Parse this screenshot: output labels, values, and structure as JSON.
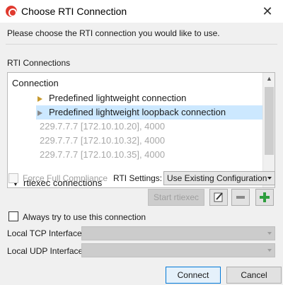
{
  "window": {
    "title": "Choose RTI Connection"
  },
  "prompt": "Please choose the RTI connection you would like to use.",
  "group_label": "RTI Connections",
  "tree": {
    "header": "Connection",
    "items": [
      {
        "label": "Predefined lightweight connection",
        "state": "normal"
      },
      {
        "label": "Predefined lightweight loopback connection",
        "state": "selected"
      },
      {
        "label": "229.7.7.7 [172.10.10.20], 4000",
        "state": "disabled"
      },
      {
        "label": "229.7.7.7 [172.10.10.32], 4000",
        "state": "disabled"
      },
      {
        "label": "229.7.7.7 [172.10.10.35], 4000",
        "state": "disabled"
      }
    ],
    "partial_row": "rtiexec connections"
  },
  "force_compliance": {
    "label": "Force Full Compliance",
    "checked": false,
    "enabled": false
  },
  "rti_settings": {
    "label": "RTI Settings:",
    "value": "Use Existing Configuration"
  },
  "buttons": {
    "start_rtiexec": "Start rtiexec",
    "connect": "Connect",
    "cancel": "Cancel"
  },
  "always_use": {
    "label": "Always try to use this connection",
    "checked": false
  },
  "local_tcp": {
    "label": "Local TCP Interface",
    "value": ""
  },
  "local_udp": {
    "label": "Local UDP Interface",
    "value": ""
  },
  "colors": {
    "accent": "#0078d7",
    "selection": "#cce8ff",
    "add_green": "#2e9e3e"
  }
}
